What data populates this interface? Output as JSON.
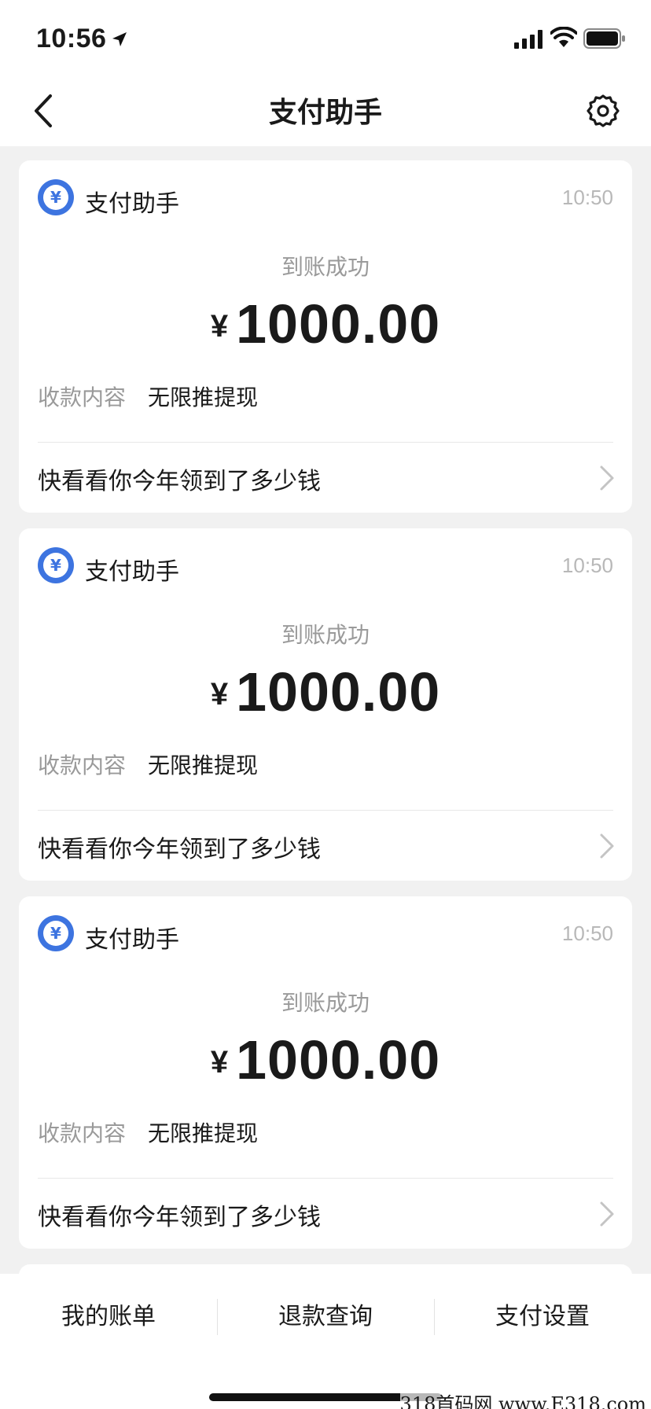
{
  "status_bar": {
    "time": "10:56",
    "icons": [
      "location-arrow-icon",
      "cellular-signal-icon",
      "wifi-icon",
      "battery-icon"
    ]
  },
  "nav": {
    "title": "支付助手",
    "back_icon": "chevron-left-icon",
    "settings_icon": "gear-icon"
  },
  "colors": {
    "accent": "#3d74e0",
    "background": "#f1f1f1",
    "card": "#ffffff",
    "muted_text": "#9a9a9a"
  },
  "messages": [
    {
      "sender": "支付助手",
      "time": "10:50",
      "status": "到账成功",
      "currency": "¥",
      "amount": "1000.00",
      "detail_label": "收款内容",
      "detail_value": "无限推提现",
      "link_text": "快看看你今年领到了多少钱"
    },
    {
      "sender": "支付助手",
      "time": "10:50",
      "status": "到账成功",
      "currency": "¥",
      "amount": "1000.00",
      "detail_label": "收款内容",
      "detail_value": "无限推提现",
      "link_text": "快看看你今年领到了多少钱"
    },
    {
      "sender": "支付助手",
      "time": "10:50",
      "status": "到账成功",
      "currency": "¥",
      "amount": "1000.00",
      "detail_label": "收款内容",
      "detail_value": "无限推提现",
      "link_text": "快看看你今年领到了多少钱"
    }
  ],
  "bottom_tabs": [
    {
      "label": "我的账单"
    },
    {
      "label": "退款查询"
    },
    {
      "label": "支付设置"
    }
  ],
  "watermark": "318首码网 www.E318.com"
}
